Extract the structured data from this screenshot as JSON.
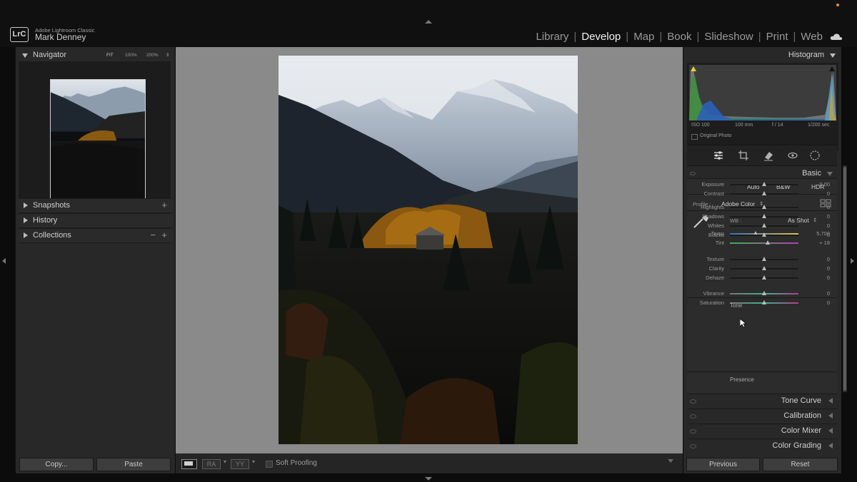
{
  "app": {
    "logo": "LrC",
    "name": "Adobe Lightroom Classic",
    "user": "Mark Denney"
  },
  "modules": [
    "Library",
    "Develop",
    "Map",
    "Book",
    "Slideshow",
    "Print",
    "Web"
  ],
  "active_module": "Develop",
  "accent_colors": {
    "notification_dot": "#e8902a"
  },
  "left": {
    "navigator": {
      "title": "Navigator",
      "zoom": [
        "FIT",
        "100%",
        "200%"
      ]
    },
    "sections": [
      {
        "label": "Snapshots",
        "actions": [
          "+"
        ]
      },
      {
        "label": "History",
        "actions": []
      },
      {
        "label": "Collections",
        "actions": [
          "−",
          "+"
        ]
      }
    ],
    "buttons": {
      "copy": "Copy...",
      "paste": "Paste"
    }
  },
  "toolbar": {
    "ra": "RA",
    "yy": "YY",
    "soft_proofing": "Soft Proofing"
  },
  "right": {
    "histogram": {
      "title": "Histogram",
      "iso": "ISO 100",
      "focal": "100 mm",
      "aperture": "f / 14",
      "shutter": "1/200 sec",
      "original_photo": "Original Photo"
    },
    "basic": {
      "title": "Basic",
      "modes": [
        "Auto",
        "B&W",
        "HDR"
      ],
      "profile_label": "Profile :",
      "profile_value": "Adobe Color",
      "wb_label": "WB :",
      "wb_value": "As Shot",
      "temp": {
        "label": "Temp",
        "value": "5,700",
        "pos": 0.38
      },
      "tint": {
        "label": "Tint",
        "value": "+ 18",
        "pos": 0.55
      },
      "tone_title": "Tone",
      "tone": [
        {
          "label": "Exposure",
          "value": "0.00",
          "pos": 0.5
        },
        {
          "label": "Contrast",
          "value": "0",
          "pos": 0.5
        }
      ],
      "tone2": [
        {
          "label": "Highlights",
          "value": "0",
          "pos": 0.5
        },
        {
          "label": "Shadows",
          "value": "0",
          "pos": 0.5
        },
        {
          "label": "Whites",
          "value": "0",
          "pos": 0.5
        },
        {
          "label": "Blacks",
          "value": "0",
          "pos": 0.5
        }
      ],
      "presence_title": "Presence",
      "presence": [
        {
          "label": "Texture",
          "value": "0",
          "pos": 0.5
        },
        {
          "label": "Clarity",
          "value": "0",
          "pos": 0.5
        },
        {
          "label": "Dehaze",
          "value": "0",
          "pos": 0.5
        }
      ],
      "presence2": [
        {
          "label": "Vibrance",
          "value": "0",
          "pos": 0.5
        },
        {
          "label": "Saturation",
          "value": "0",
          "pos": 0.5
        }
      ]
    },
    "panels": [
      "Tone Curve",
      "Calibration",
      "Color Mixer",
      "Color Grading"
    ],
    "buttons": {
      "previous": "Previous",
      "reset": "Reset"
    }
  }
}
